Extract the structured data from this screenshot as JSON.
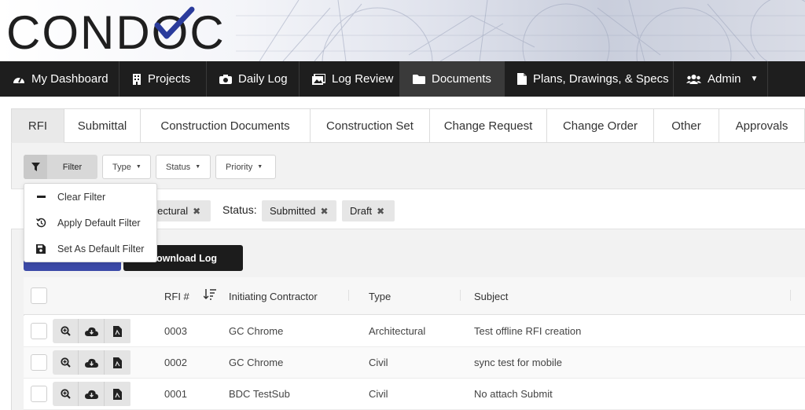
{
  "brand": {
    "logo_text": "CONDOC"
  },
  "nav": {
    "items": [
      {
        "label": "My Dashboard",
        "icon": "dashboard-icon"
      },
      {
        "label": "Projects",
        "icon": "building-icon"
      },
      {
        "label": "Daily Log",
        "icon": "camera-icon"
      },
      {
        "label": "Log Review",
        "icon": "images-icon"
      },
      {
        "label": "Documents",
        "icon": "folder-icon",
        "active": true
      },
      {
        "label": "Plans, Drawings, & Specs",
        "icon": "file-icon"
      },
      {
        "label": "Admin",
        "icon": "users-icon",
        "has_dropdown": true
      }
    ]
  },
  "tabs": [
    {
      "label": "RFI",
      "active": true
    },
    {
      "label": "Submittal"
    },
    {
      "label": "Construction Documents"
    },
    {
      "label": "Construction Set"
    },
    {
      "label": "Change Request"
    },
    {
      "label": "Change Order"
    },
    {
      "label": "Other"
    },
    {
      "label": "Approvals"
    }
  ],
  "filters": {
    "filter_label": "Filter",
    "type_label": "Type",
    "status_label": "Status",
    "priority_label": "Priority"
  },
  "filter_menu": [
    {
      "label": "Clear Filter",
      "icon": "minus-icon"
    },
    {
      "label": "Apply Default Filter",
      "icon": "history-icon"
    },
    {
      "label": "Set As Default Filter",
      "icon": "save-icon"
    }
  ],
  "active_filters": {
    "type_chip": "ctectural",
    "status_title": "Status:",
    "status_chips": [
      "Submitted",
      "Draft"
    ],
    "remove_glyph": "✖"
  },
  "buttons": {
    "download_log": "Download Log"
  },
  "table": {
    "columns": {
      "rfi": "RFI #",
      "contractor": "Initiating Contractor",
      "type": "Type",
      "subject": "Subject"
    },
    "rows": [
      {
        "rfi": "0003",
        "contractor": "GC Chrome",
        "type": "Architectural",
        "subject": "Test offline RFI creation"
      },
      {
        "rfi": "0002",
        "contractor": "GC Chrome",
        "type": "Civil",
        "subject": "sync test for mobile"
      },
      {
        "rfi": "0001",
        "contractor": "BDC TestSub",
        "type": "Civil",
        "subject": "No attach Submit"
      }
    ]
  },
  "colors": {
    "nav_bg": "#1e1e1e",
    "nav_active": "#3a3a3a",
    "accent_blue": "#3c4aa8",
    "logo_check": "#2b3c9c"
  }
}
